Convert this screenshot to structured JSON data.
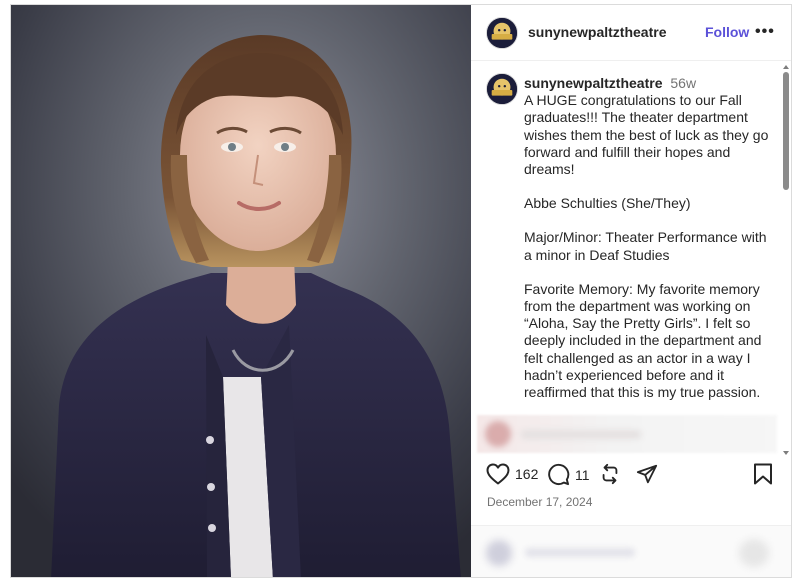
{
  "post": {
    "username": "sunynewpaltztheatre",
    "follow_label": "Follow",
    "more_label": "•••",
    "time_ago": "56w",
    "caption_paragraphs": [
      "A HUGE congratulations to our Fall graduates!!! The theater department wishes them the best of luck as they go forward and fulfill their hopes and dreams!",
      "Abbe Schulties (She/They)",
      "Major/Minor: Theater Performance with a minor in Deaf Studies",
      "Favorite Memory: My favorite memory from the department was working on “Aloha, Say the Pretty Girls”. I felt so deeply included in the department and felt challenged as an actor in a way I hadn’t experienced before and it reaffirmed that this is my true passion."
    ],
    "likes_count": "162",
    "comments_count": "11",
    "date": "December 17, 2024"
  },
  "icons": {
    "like": "heart-icon",
    "comment": "speech-bubble-icon",
    "share": "repost-icon",
    "send": "paper-plane-icon",
    "save": "bookmark-icon",
    "more": "ellipsis-icon"
  },
  "colors": {
    "follow": "#5b51d8",
    "text": "#262626",
    "muted": "#737373",
    "photo_backdrop": "#4a4c58",
    "shirt": "#2c2a45"
  }
}
